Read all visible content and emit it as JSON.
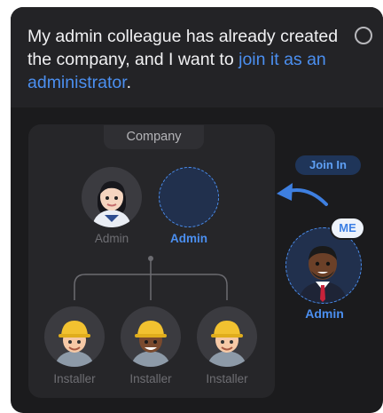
{
  "question": {
    "text_plain": "My admin colleague has already created the company, and I want to",
    "text_link": "join it as an administrator",
    "text_end": "."
  },
  "org": {
    "title": "Company",
    "admin_label": "Admin",
    "new_admin_label": "Admin",
    "installers": [
      "Installer",
      "Installer",
      "Installer"
    ]
  },
  "join": {
    "pill": "Join In",
    "me_badge": "ME",
    "me_label": "Admin"
  },
  "colors": {
    "accent": "#4b8ff0",
    "card_bg": "#1b1b1d",
    "panel_bg": "#262629"
  },
  "icons": [
    "radio-icon",
    "avatar-admin-woman",
    "avatar-installer",
    "avatar-me-man",
    "curved-arrow-icon"
  ]
}
